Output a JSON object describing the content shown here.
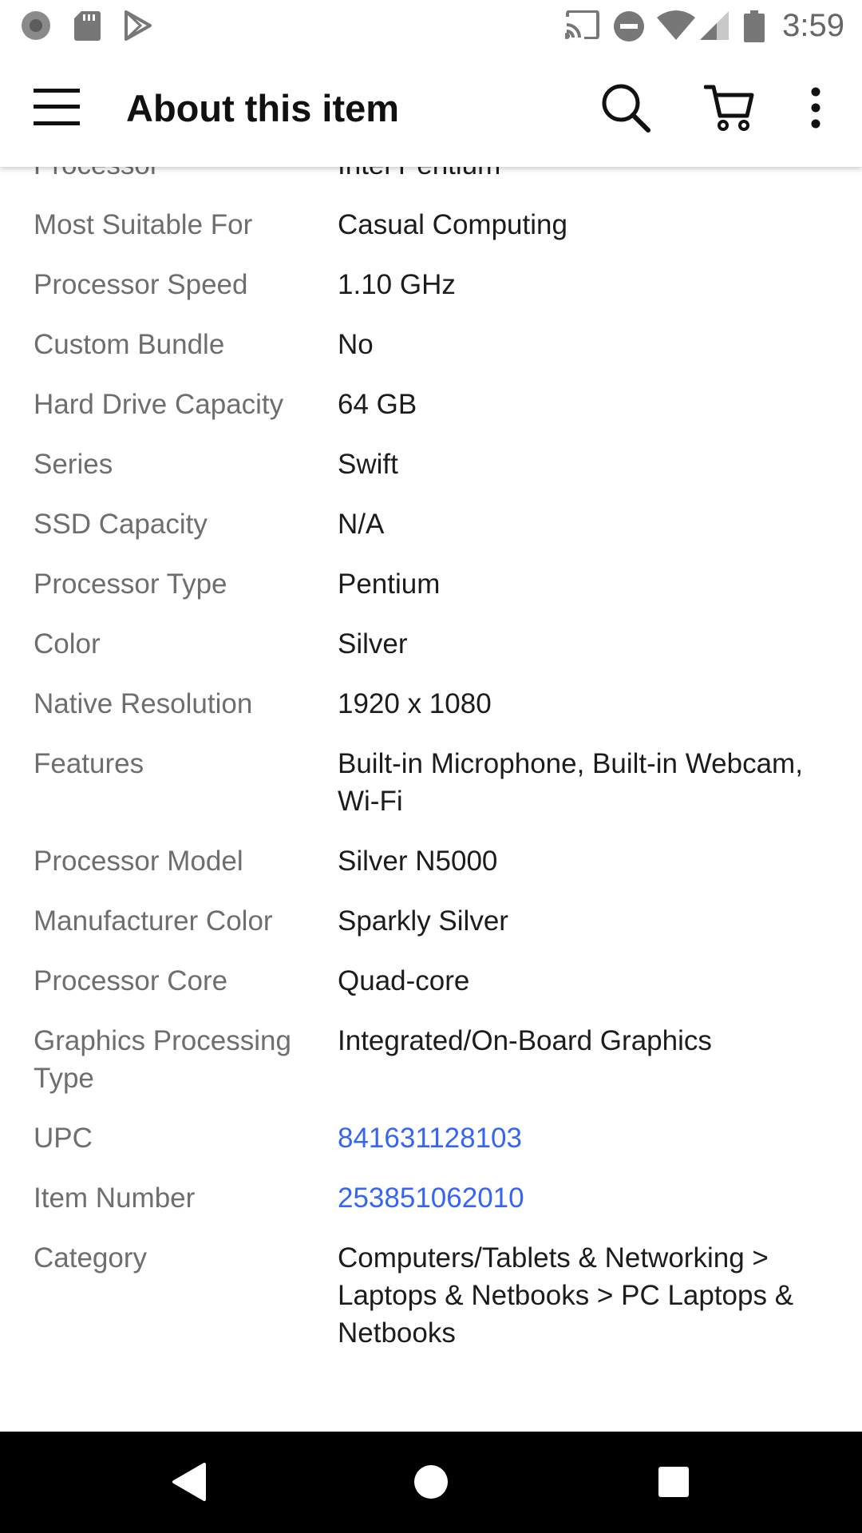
{
  "status_bar": {
    "time": "3:59",
    "left_icons": [
      "circle-icon",
      "sd-card-icon",
      "play-store-icon"
    ],
    "right_icons": [
      "cast-icon",
      "do-not-disturb-icon",
      "wifi-icon",
      "signal-icon",
      "battery-icon"
    ]
  },
  "app_bar": {
    "title": "About this item",
    "icons": [
      "menu-icon",
      "search-icon",
      "cart-icon",
      "more-vert-icon"
    ]
  },
  "specs": [
    {
      "label": "Processor",
      "value": "Intel Pentium"
    },
    {
      "label": "Most Suitable For",
      "value": "Casual Computing"
    },
    {
      "label": "Processor Speed",
      "value": "1.10 GHz"
    },
    {
      "label": "Custom Bundle",
      "value": "No"
    },
    {
      "label": "Hard Drive Capacity",
      "value": "64 GB"
    },
    {
      "label": "Series",
      "value": "Swift"
    },
    {
      "label": "SSD Capacity",
      "value": "N/A"
    },
    {
      "label": "Processor Type",
      "value": "Pentium"
    },
    {
      "label": "Color",
      "value": "Silver"
    },
    {
      "label": "Native Resolution",
      "value": "1920 x 1080"
    },
    {
      "label": "Features",
      "value": "Built-in Microphone, Built-in Webcam, Wi-Fi"
    },
    {
      "label": "Processor Model",
      "value": "Silver N5000"
    },
    {
      "label": "Manufacturer Color",
      "value": "Sparkly Silver"
    },
    {
      "label": "Processor Core",
      "value": "Quad-core"
    },
    {
      "label": "Graphics Processing Type",
      "value": "Integrated/On-Board Graphics"
    },
    {
      "label": "UPC",
      "value": "841631128103"
    },
    {
      "label": "Item Number",
      "value": "253851062010"
    },
    {
      "label": "Category",
      "value": "Computers/Tablets & Networking > Laptops & Netbooks > PC Laptops & Netbooks"
    }
  ],
  "colors": {
    "link": "#3665f3",
    "label": "#6e6e6e",
    "value": "#1c1c1c"
  },
  "nav_bar": {
    "icons": [
      "back-icon",
      "home-icon",
      "recents-icon"
    ]
  }
}
